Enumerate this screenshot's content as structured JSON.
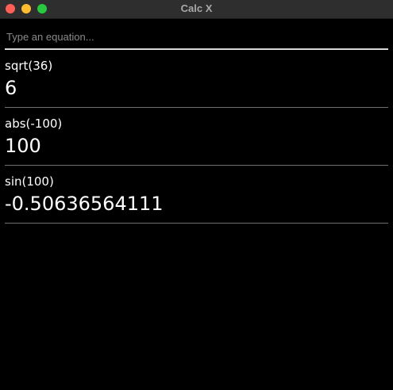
{
  "window": {
    "title": "Calc X"
  },
  "input": {
    "placeholder": "Type an equation...",
    "value": ""
  },
  "results": [
    {
      "expression": "sqrt(36)",
      "value": "6"
    },
    {
      "expression": "abs(-100)",
      "value": "100"
    },
    {
      "expression": "sin(100)",
      "value": "-0.50636564111"
    }
  ]
}
